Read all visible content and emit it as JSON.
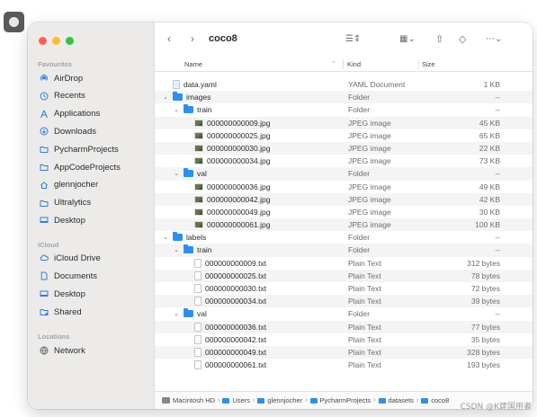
{
  "window": {
    "title": "coco8"
  },
  "sidebar": {
    "favourites_label": "Favourites",
    "favourites": [
      {
        "label": "AirDrop",
        "icon": "airdrop-icon"
      },
      {
        "label": "Recents",
        "icon": "clock-icon"
      },
      {
        "label": "Applications",
        "icon": "applications-icon"
      },
      {
        "label": "Downloads",
        "icon": "download-icon"
      },
      {
        "label": "PycharmProjects",
        "icon": "folder-icon"
      },
      {
        "label": "AppCodeProjects",
        "icon": "folder-icon"
      },
      {
        "label": "glennjocher",
        "icon": "home-icon"
      },
      {
        "label": "Ultralytics",
        "icon": "folder-icon"
      },
      {
        "label": "Desktop",
        "icon": "desktop-icon"
      }
    ],
    "icloud_label": "iCloud",
    "icloud": [
      {
        "label": "iCloud Drive",
        "icon": "cloud-icon"
      },
      {
        "label": "Documents",
        "icon": "document-icon"
      },
      {
        "label": "Desktop",
        "icon": "desktop-icon"
      },
      {
        "label": "Shared",
        "icon": "shared-folder-icon"
      }
    ],
    "locations_label": "Locations",
    "locations": [
      {
        "label": "Network",
        "icon": "network-icon"
      }
    ]
  },
  "columns": {
    "name": "Name",
    "kind": "Kind",
    "size": "Size"
  },
  "rows": [
    {
      "name": "data.yaml",
      "kind": "YAML Document",
      "size": "1 KB",
      "type": "yaml",
      "depth": 0,
      "expandable": false
    },
    {
      "name": "images",
      "kind": "Folder",
      "size": "--",
      "type": "folder",
      "depth": 0,
      "expandable": true
    },
    {
      "name": "train",
      "kind": "Folder",
      "size": "--",
      "type": "folder",
      "depth": 1,
      "expandable": true
    },
    {
      "name": "000000000009.jpg",
      "kind": "JPEG image",
      "size": "45 KB",
      "type": "image",
      "depth": 2,
      "expandable": false
    },
    {
      "name": "000000000025.jpg",
      "kind": "JPEG image",
      "size": "65 KB",
      "type": "image",
      "depth": 2,
      "expandable": false
    },
    {
      "name": "000000000030.jpg",
      "kind": "JPEG image",
      "size": "22 KB",
      "type": "image",
      "depth": 2,
      "expandable": false
    },
    {
      "name": "000000000034.jpg",
      "kind": "JPEG image",
      "size": "73 KB",
      "type": "image",
      "depth": 2,
      "expandable": false
    },
    {
      "name": "val",
      "kind": "Folder",
      "size": "--",
      "type": "folder",
      "depth": 1,
      "expandable": true
    },
    {
      "name": "000000000036.jpg",
      "kind": "JPEG image",
      "size": "49 KB",
      "type": "image",
      "depth": 2,
      "expandable": false
    },
    {
      "name": "000000000042.jpg",
      "kind": "JPEG image",
      "size": "42 KB",
      "type": "image",
      "depth": 2,
      "expandable": false
    },
    {
      "name": "000000000049.jpg",
      "kind": "JPEG image",
      "size": "30 KB",
      "type": "image",
      "depth": 2,
      "expandable": false
    },
    {
      "name": "000000000061.jpg",
      "kind": "JPEG image",
      "size": "100 KB",
      "type": "image",
      "depth": 2,
      "expandable": false
    },
    {
      "name": "labels",
      "kind": "Folder",
      "size": "--",
      "type": "folder",
      "depth": 0,
      "expandable": true
    },
    {
      "name": "train",
      "kind": "Folder",
      "size": "--",
      "type": "folder",
      "depth": 1,
      "expandable": true
    },
    {
      "name": "000000000009.txt",
      "kind": "Plain Text",
      "size": "312 bytes",
      "type": "text",
      "depth": 2,
      "expandable": false
    },
    {
      "name": "000000000025.txt",
      "kind": "Plain Text",
      "size": "78 bytes",
      "type": "text",
      "depth": 2,
      "expandable": false
    },
    {
      "name": "000000000030.txt",
      "kind": "Plain Text",
      "size": "72 bytes",
      "type": "text",
      "depth": 2,
      "expandable": false
    },
    {
      "name": "000000000034.txt",
      "kind": "Plain Text",
      "size": "39 bytes",
      "type": "text",
      "depth": 2,
      "expandable": false
    },
    {
      "name": "val",
      "kind": "Folder",
      "size": "--",
      "type": "folder",
      "depth": 1,
      "expandable": true
    },
    {
      "name": "000000000036.txt",
      "kind": "Plain Text",
      "size": "77 bytes",
      "type": "text",
      "depth": 2,
      "expandable": false
    },
    {
      "name": "000000000042.txt",
      "kind": "Plain Text",
      "size": "35 bytes",
      "type": "text",
      "depth": 2,
      "expandable": false
    },
    {
      "name": "000000000049.txt",
      "kind": "Plain Text",
      "size": "328 bytes",
      "type": "text",
      "depth": 2,
      "expandable": false
    },
    {
      "name": "000000000061.txt",
      "kind": "Plain Text",
      "size": "193 bytes",
      "type": "text",
      "depth": 2,
      "expandable": false
    }
  ],
  "pathbar": [
    "Macintosh HD",
    "Users",
    "glennjocher",
    "PycharmProjects",
    "datasets",
    "coco8"
  ],
  "watermark": "CSDN @K建国用者",
  "colors": {
    "accent": "#2d8ff0",
    "sidebar_bg": "#ecebea"
  }
}
